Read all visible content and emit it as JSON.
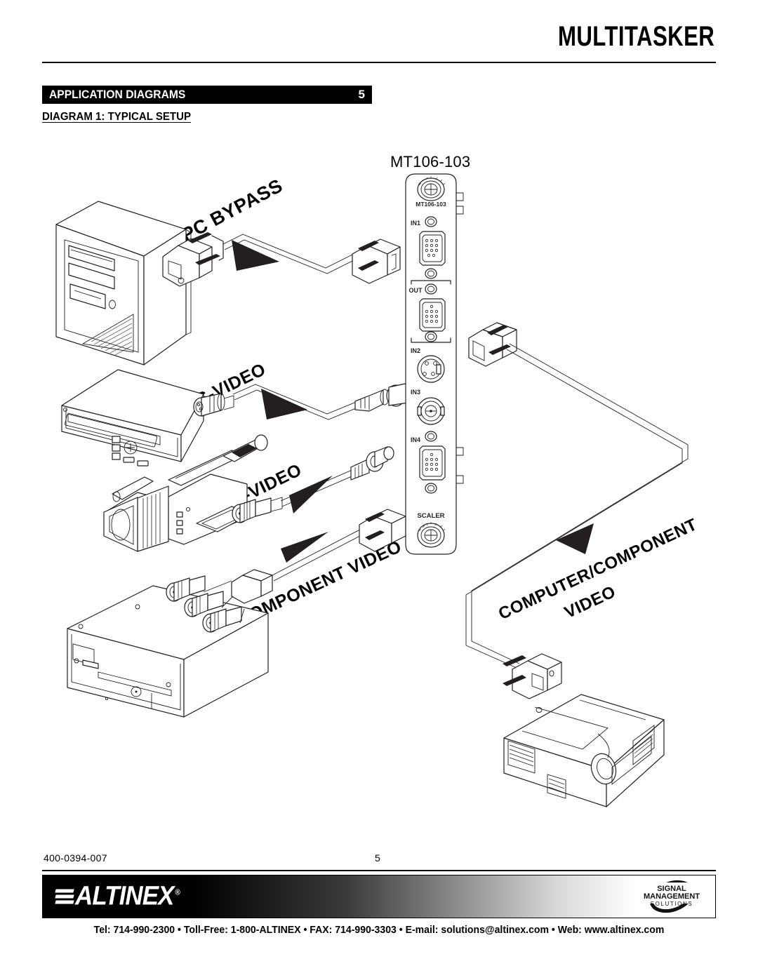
{
  "header": {
    "brand_title": "MULTITASKER"
  },
  "section": {
    "title": "APPLICATION DIAGRAMS",
    "number": "5",
    "subtitle": "DIAGRAM 1: TYPICAL SETUP"
  },
  "diagram": {
    "device_title": "MT106-103",
    "cable_labels": {
      "pc_bypass": "PC BYPASS",
      "s_video": "S-VIDEO",
      "c_video": "C-VIDEO",
      "component_video": "COMPONENT VIDEO",
      "computer_component_line1": "COMPUTER/COMPONENT",
      "computer_component_line2": "VIDEO"
    },
    "panel": {
      "silkscreen_model": "MT106-103",
      "ports": [
        {
          "label": "IN1",
          "type": "hd15-vga"
        },
        {
          "label": "OUT",
          "type": "hd15-vga"
        },
        {
          "label": "IN2",
          "type": "s-video-din"
        },
        {
          "label": "IN3",
          "type": "bnc"
        },
        {
          "label": "IN4",
          "type": "hd15-vga"
        },
        {
          "label": "SCALER",
          "type": "thumbscrew"
        }
      ]
    },
    "equipment": [
      {
        "name": "desktop-computer"
      },
      {
        "name": "vcr-deck"
      },
      {
        "name": "camcorder"
      },
      {
        "name": "dvd-player"
      },
      {
        "name": "projector"
      }
    ]
  },
  "footer": {
    "doc_number": "400-0394-007",
    "page_number": "5",
    "logo_text": "ALTINEX",
    "logo_registered": "®",
    "tagline_line1": "SIGNAL",
    "tagline_line2": "MANAGEMENT",
    "tagline_line3": "SOLUTIONS",
    "contact": "Tel: 714-990-2300 • Toll-Free: 1-800-ALTINEX • FAX: 714-990-3303 • E-mail: solutions@altinex.com • Web: www.altinex.com"
  }
}
